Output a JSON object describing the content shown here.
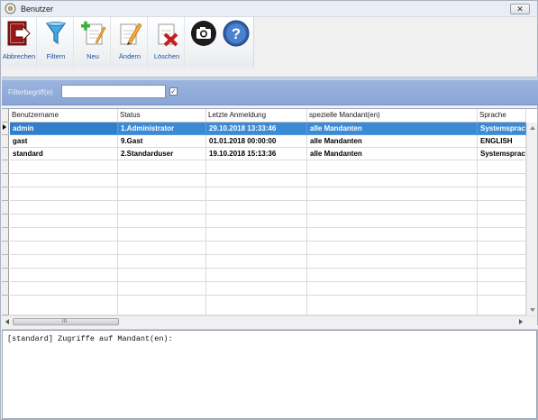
{
  "window": {
    "title": "Benutzer",
    "close_glyph": "✕"
  },
  "toolbar": {
    "buttons": [
      {
        "label": "Abbrechen",
        "icon": "exit-door-icon"
      },
      {
        "label": "Filtern",
        "icon": "funnel-icon"
      },
      {
        "label": "Neu",
        "icon": "add-document-icon"
      },
      {
        "label": "Ändern",
        "icon": "edit-pencil-icon"
      },
      {
        "label": "Löschen",
        "icon": "delete-document-icon"
      }
    ],
    "extra_icons": [
      "camera-icon",
      "help-icon"
    ]
  },
  "filter": {
    "label": "Filterbegriff(e)",
    "value": "",
    "checkbox_checked": true,
    "check_glyph": "✓"
  },
  "table": {
    "columns": [
      "Benutzername",
      "Status",
      "Letzte Anmeldung",
      "spezielle Mandant(en)",
      "Sprache"
    ],
    "rows": [
      [
        "admin",
        "1.Administrator",
        "29.10.2018 13:33:46",
        "alle Mandanten",
        "Systemsprache"
      ],
      [
        "gast",
        "9.Gast",
        "01.01.2018 00:00:00",
        "alle Mandanten",
        "ENGLISH"
      ],
      [
        "standard",
        "2.Standarduser",
        "19.10.2018 15:13:36",
        "alle Mandanten",
        "Systemsprache"
      ]
    ],
    "selected_row": 0
  },
  "scrollbar": {
    "grip": "III"
  },
  "details": {
    "text": "[standard] Zugriffe auf Mandant(en):"
  },
  "colors": {
    "selected_row": "#3a8ad6",
    "filterbar": "#9bb4df",
    "label_blue": "#1a4f9c"
  }
}
